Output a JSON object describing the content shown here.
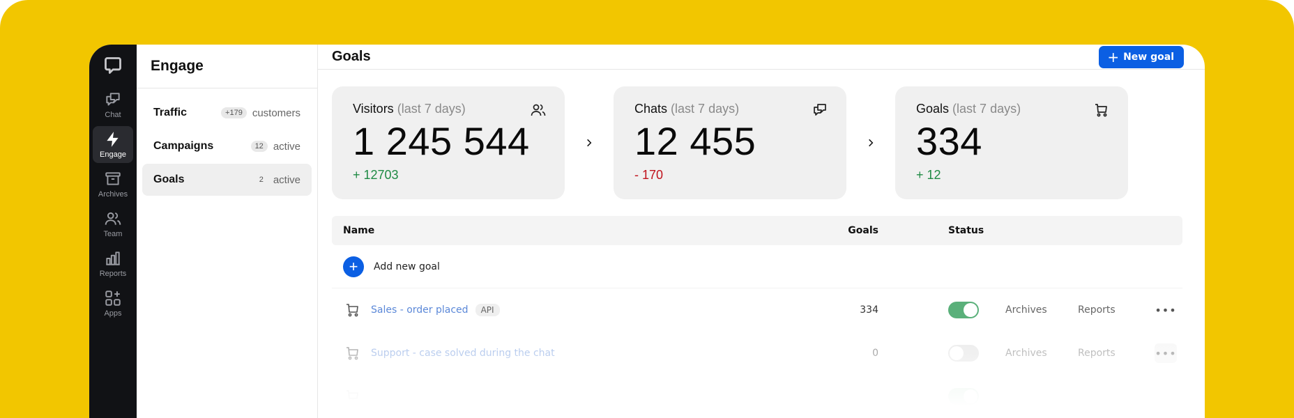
{
  "rail": {
    "logo": "chat-bubble-logo",
    "items": [
      {
        "label": "Chat",
        "icon": "chats-icon",
        "active": false
      },
      {
        "label": "Engage",
        "icon": "lightning-icon",
        "active": true
      },
      {
        "label": "Archives",
        "icon": "archive-box-icon",
        "active": false
      },
      {
        "label": "Team",
        "icon": "team-icon",
        "active": false
      },
      {
        "label": "Reports",
        "icon": "bar-chart-icon",
        "active": false
      },
      {
        "label": "Apps",
        "icon": "apps-grid-icon",
        "active": false
      }
    ]
  },
  "side": {
    "title": "Engage",
    "items": [
      {
        "name": "Traffic",
        "badge": "+179",
        "suffix": "customers",
        "active": false
      },
      {
        "name": "Campaigns",
        "badge": "12",
        "suffix": "active",
        "active": false
      },
      {
        "name": "Goals",
        "badge": "2",
        "suffix": "active",
        "active": true
      }
    ]
  },
  "main": {
    "title": "Goals",
    "new_goal_label": "New goal",
    "stats": [
      {
        "label": "Visitors",
        "period": "(last 7 days)",
        "value": "1 245 544",
        "delta": "+ 12703",
        "trend": "up",
        "icon": "users-icon"
      },
      {
        "label": "Chats",
        "period": "(last 7 days)",
        "value": "12 455",
        "delta": "- 170",
        "trend": "down",
        "icon": "chats-icon"
      },
      {
        "label": "Goals",
        "period": "(last 7 days)",
        "value": "334",
        "delta": "+ 12",
        "trend": "up",
        "icon": "cart-icon"
      }
    ],
    "table": {
      "columns": {
        "name": "Name",
        "goals": "Goals",
        "status": "Status"
      },
      "add_label": "Add new goal",
      "rows": [
        {
          "name": "Sales - order placed",
          "tag": "API",
          "goals": "334",
          "enabled": true,
          "archives": "Archives",
          "reports": "Reports",
          "more": "•••"
        },
        {
          "name": "Support - case solved during the chat",
          "tag": "",
          "goals": "0",
          "enabled": false,
          "archives": "Archives",
          "reports": "Reports",
          "more": "•••"
        }
      ]
    }
  },
  "colors": {
    "accent": "#0b5fe3",
    "backdrop": "#f2c600",
    "rail": "#111215",
    "positive": "#1f8a44",
    "negative": "#c0121c",
    "toggle_on": "#5ab07a"
  }
}
